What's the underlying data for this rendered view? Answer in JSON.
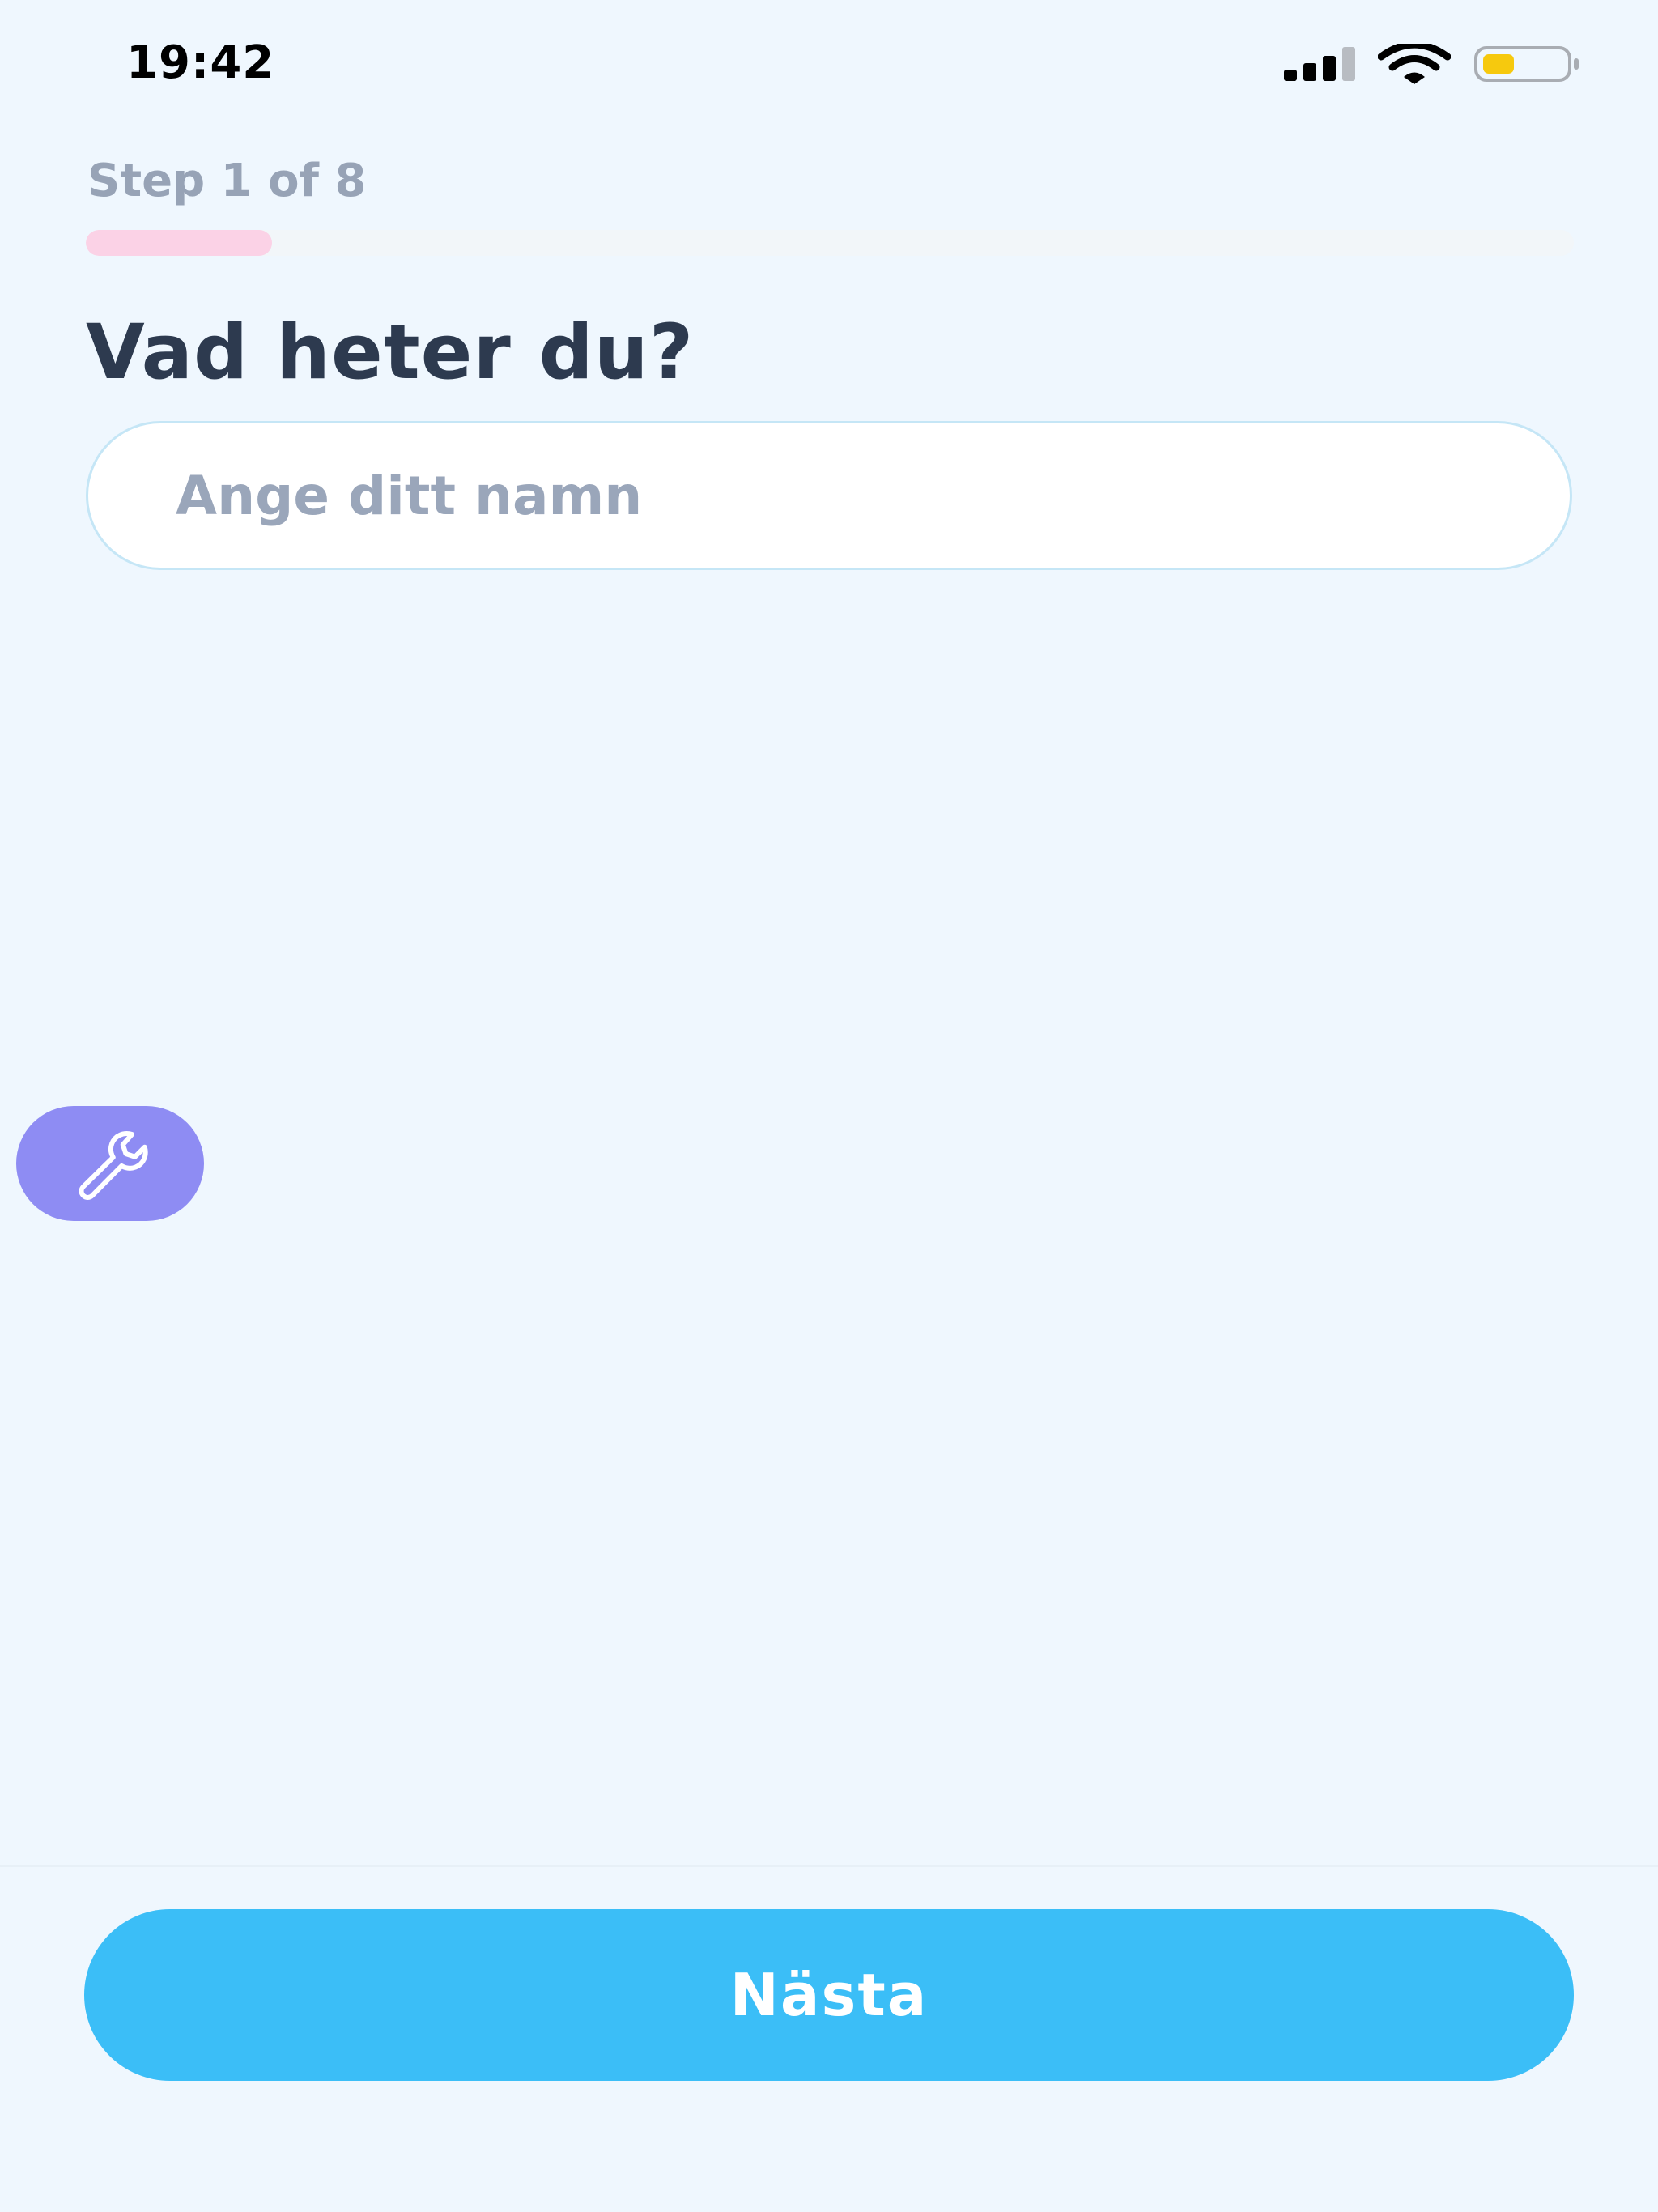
{
  "status_bar": {
    "time": "19:42",
    "signal_icon": "cellular-signal-icon",
    "wifi_icon": "wifi-icon",
    "battery_icon": "battery-icon",
    "battery_color": "#f6c90e"
  },
  "onboarding": {
    "step_label": "Step 1 of 8",
    "progress_fraction": 0.125,
    "progress_color": "#fbd2e6",
    "title": "Vad heter du?",
    "name_input": {
      "placeholder": "Ange ditt namn",
      "value": ""
    }
  },
  "floating_tool": {
    "icon": "wrench-icon",
    "color": "#8e8cf3"
  },
  "footer": {
    "next_label": "Nästa",
    "next_color": "#3bbef7"
  }
}
